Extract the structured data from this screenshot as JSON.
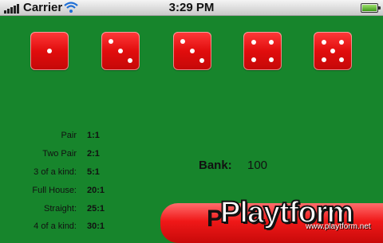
{
  "status_bar": {
    "carrier": "Carrier",
    "time": "3:29 PM"
  },
  "dice": [
    1,
    3,
    3,
    4,
    5
  ],
  "payouts": [
    {
      "hand": "Pair",
      "odds": "1:1"
    },
    {
      "hand": "Two Pair",
      "odds": "2:1"
    },
    {
      "hand": "3 of a kind:",
      "odds": "5:1"
    },
    {
      "hand": "Full House:",
      "odds": "20:1"
    },
    {
      "hand": "Straight:",
      "odds": "25:1"
    },
    {
      "hand": "4 of a kind:",
      "odds": "30:1"
    }
  ],
  "bank": {
    "label": "Bank:",
    "value": "100"
  },
  "play_button": {
    "label": "P"
  },
  "watermark": {
    "brand": "Playtform",
    "url": "www.playtform.net"
  },
  "colors": {
    "table": "#17852c",
    "die": "#e10d0d"
  }
}
